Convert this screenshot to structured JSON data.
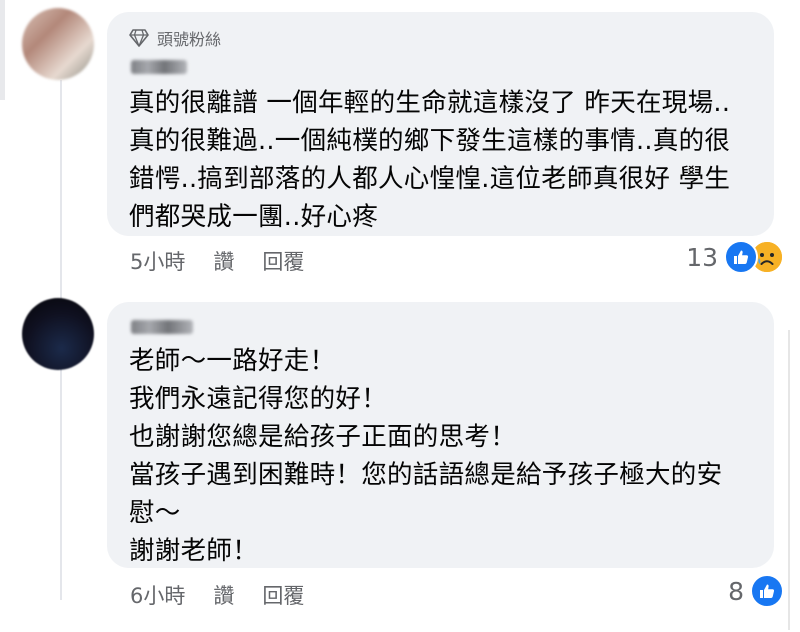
{
  "comments": [
    {
      "badge": "頭號粉絲",
      "lines": [
        "真的很離譜 一個年輕的生命就這樣沒了 昨天在現場..",
        "真的很難過..一個純樸的鄉下發生這樣的事情..真的很",
        "錯愕..搞到部落的人都人心惶惶.這位老師真很好 學生",
        "們都哭成一團..好心疼"
      ],
      "time": "5小時",
      "like_label": "讚",
      "reply_label": "回覆",
      "reaction_count": "13",
      "reactions": [
        "like-icon",
        "sad-icon"
      ]
    },
    {
      "lines": [
        "老師～一路好走！",
        "我們永遠記得您的好！",
        "也謝謝您總是給孩子正面的思考！",
        "當孩子遇到困難時！您的話語總是給予孩子極大的安",
        "慰～",
        "謝謝老師！"
      ],
      "time": "6小時",
      "like_label": "讚",
      "reply_label": "回覆",
      "reaction_count": "8",
      "reactions": [
        "like-icon"
      ]
    }
  ],
  "colors": {
    "bubble": "#f0f2f5",
    "meta_text": "#65676b",
    "like_blue": "#1877f2",
    "sad_yellow": "#f7b125"
  }
}
